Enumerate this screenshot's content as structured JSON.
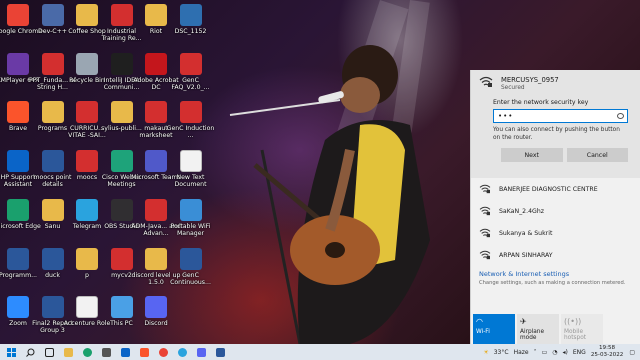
{
  "desktop": {
    "icons": [
      {
        "label": "Google Chrome",
        "icon": "chrome-icon",
        "color": "#ea4335"
      },
      {
        "label": "Dev-C++",
        "icon": "devcpp-icon",
        "color": "#4a6aa8"
      },
      {
        "label": "Coffee Shop",
        "icon": "folder-icon",
        "color": "#e8b94a"
      },
      {
        "label": "Industrial Training Re...",
        "icon": "pdf-icon",
        "color": "#d32f2f"
      },
      {
        "label": "Riot",
        "icon": "folder-icon",
        "color": "#e8b94a"
      },
      {
        "label": "DSC_1152",
        "icon": "photo-icon",
        "color": "#2e6fb0"
      },
      {
        "label": "KMPlayer 64X",
        "icon": "kmplayer-icon",
        "color": "#6a3aa6"
      },
      {
        "label": "PPT_Funda... of String H...",
        "icon": "pdf-icon",
        "color": "#d32f2f"
      },
      {
        "label": "Recycle Bin",
        "icon": "recycle-bin-icon",
        "color": "#9aa6b2"
      },
      {
        "label": "IntelliJ IDEA Communi...",
        "icon": "intellij-icon",
        "color": "#1f1f1f"
      },
      {
        "label": "Adobe Acrobat DC",
        "icon": "acrobat-icon",
        "color": "#c4161c"
      },
      {
        "label": "GenC FAQ_V2.0_...",
        "icon": "pdf-icon",
        "color": "#d32f2f"
      },
      {
        "label": "Brave",
        "icon": "brave-icon",
        "color": "#fb542b"
      },
      {
        "label": "Programs",
        "icon": "folder-icon",
        "color": "#e8b94a"
      },
      {
        "label": "CURRICU... VITAE -SAI...",
        "icon": "pdf-icon",
        "color": "#d32f2f"
      },
      {
        "label": "sylius-publi...",
        "icon": "folder-icon",
        "color": "#e8b94a"
      },
      {
        "label": "makaut marksheet",
        "icon": "pdf-icon",
        "color": "#d32f2f"
      },
      {
        "label": "GenC Induction ...",
        "icon": "pdf-icon",
        "color": "#d32f2f"
      },
      {
        "label": "HP Support Assistant",
        "icon": "help-icon",
        "color": "#0a64c8"
      },
      {
        "label": "moocs point details",
        "icon": "word-icon",
        "color": "#2b579a"
      },
      {
        "label": "moocs",
        "icon": "pdf-icon",
        "color": "#d32f2f"
      },
      {
        "label": "Cisco Webex Meetings",
        "icon": "webex-icon",
        "color": "#1ea37a"
      },
      {
        "label": "Microsoft Teams",
        "icon": "teams-icon",
        "color": "#5059c9"
      },
      {
        "label": "New Text Document",
        "icon": "text-file-icon",
        "color": "#f2f2f2"
      },
      {
        "label": "Microsoft Edge",
        "icon": "edge-icon",
        "color": "#1aa06d"
      },
      {
        "label": "Sanu",
        "icon": "folder-icon",
        "color": "#e8b94a"
      },
      {
        "label": "Telegram",
        "icon": "telegram-icon",
        "color": "#2aa3de"
      },
      {
        "label": "OBS Studio",
        "icon": "obs-icon",
        "color": "#302e31"
      },
      {
        "label": "ADM-Java... and Advan...",
        "icon": "pdf-icon",
        "color": "#d32f2f"
      },
      {
        "label": "Portable WiFi Manager",
        "icon": "wifi-manager-icon",
        "color": "#3a8ed6"
      },
      {
        "label": "Programm...",
        "icon": "word-icon",
        "color": "#2b579a"
      },
      {
        "label": "duck",
        "icon": "word-icon",
        "color": "#2b579a"
      },
      {
        "label": "p",
        "icon": "folder-icon",
        "color": "#e8b94a"
      },
      {
        "label": "mycv2",
        "icon": "pdf-icon",
        "color": "#d32f2f"
      },
      {
        "label": "discord level up 1.5.0",
        "icon": "folder-icon",
        "color": "#e8b94a"
      },
      {
        "label": "GenC Continuous...",
        "icon": "word-icon",
        "color": "#2b579a"
      },
      {
        "label": "Zoom",
        "icon": "zoom-icon",
        "color": "#2d8cff"
      },
      {
        "label": "Final2 Report Group 3",
        "icon": "word-icon",
        "color": "#2b579a"
      },
      {
        "label": "Accenture Role",
        "icon": "text-file-icon",
        "color": "#f2f2f2"
      },
      {
        "label": "This PC",
        "icon": "this-pc-icon",
        "color": "#4aa0e6"
      },
      {
        "label": "Discord",
        "icon": "discord-icon",
        "color": "#5865f2"
      }
    ]
  },
  "network_flyout": {
    "connecting": {
      "ssid": "MERCUSYS_0957",
      "status": "Secured",
      "prompt": "Enter the network security key",
      "password_value": "•••",
      "hint": "You can also connect by pushing the button on the router.",
      "next_label": "Next",
      "cancel_label": "Cancel"
    },
    "networks": [
      "BANERJEE DIAGNOSTIC CENTRE",
      "SaKaN_2.4Ghz",
      "Sukanya & Sukrit",
      "ARPAN SINHARAY"
    ],
    "settings_link": "Network & Internet settings",
    "settings_sub": "Change settings, such as making a connection metered.",
    "tiles": [
      {
        "label": "Wi-Fi",
        "state": "active"
      },
      {
        "label": "Airplane mode",
        "state": "normal"
      },
      {
        "label": "Mobile hotspot",
        "state": "disabled"
      }
    ]
  },
  "taskbar": {
    "weather": "33°C",
    "condition": "Haze",
    "language": "ENG",
    "time": "19:58",
    "date": "25-03-2022"
  }
}
